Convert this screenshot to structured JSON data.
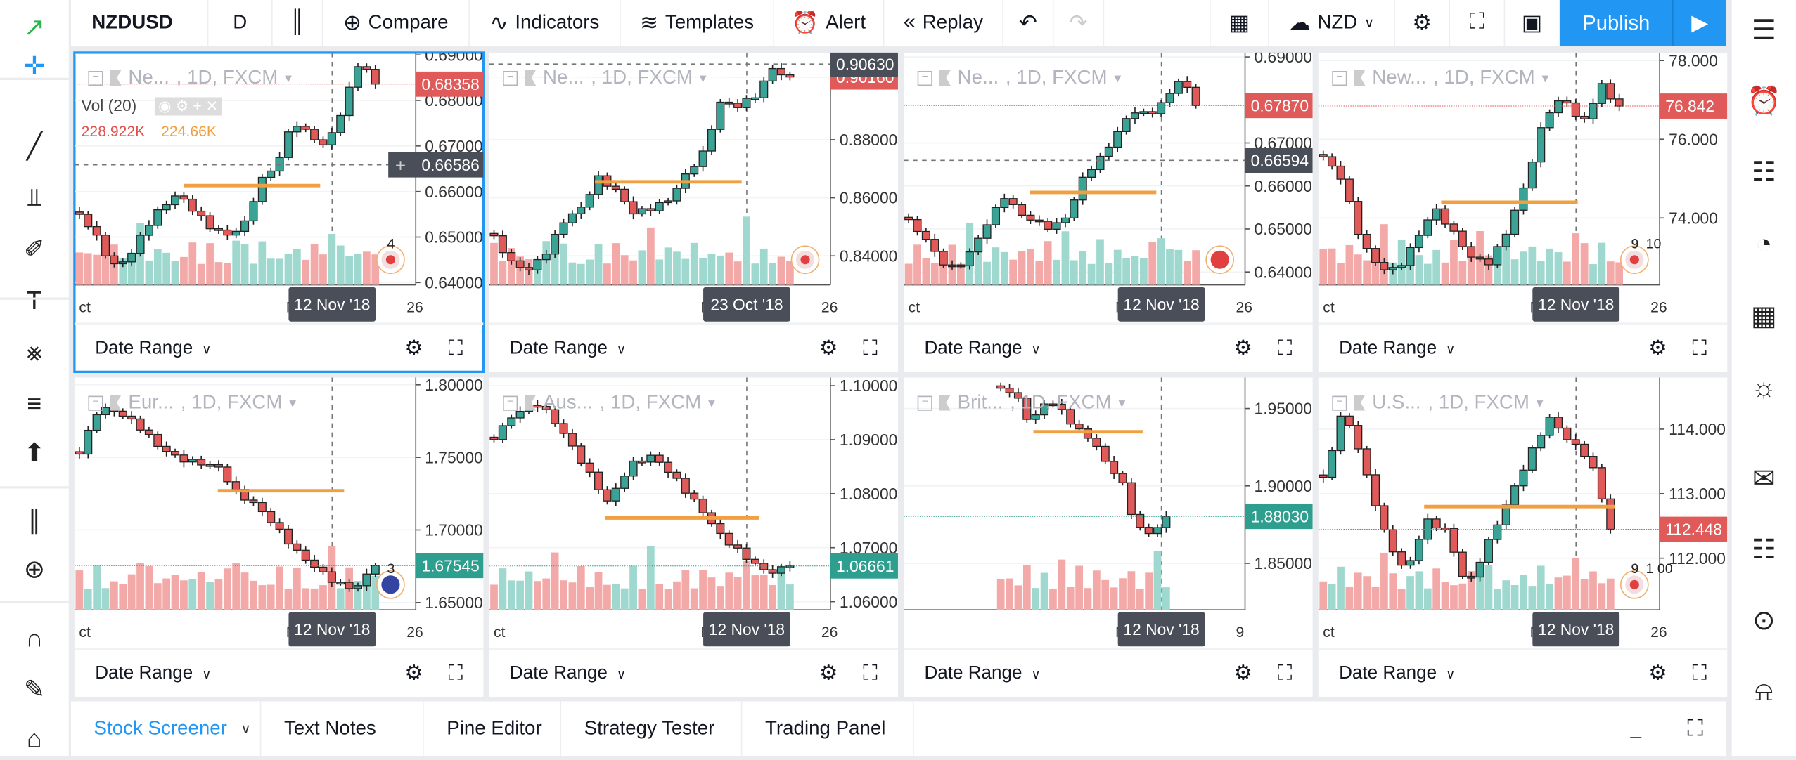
{
  "topbar": {
    "symbol": "NZDUSD",
    "interval": "D",
    "compare": "Compare",
    "indicators": "Indicators",
    "templates": "Templates",
    "alert": "Alert",
    "replay": "Replay",
    "currency": "NZD",
    "publish": "Publish",
    "icons": {
      "bar_style": "candles-icon",
      "compare": "plus-circle-icon",
      "indicators": "indicator-wave-icon",
      "templates": "templates-icon",
      "alert": "alarm-clock-icon",
      "replay": "rewind-icon",
      "undo": "undo-icon",
      "redo": "redo-icon",
      "layout": "grid-layout-icon",
      "cloud": "cloud-check-icon",
      "settings": "gear-icon",
      "fullscreen": "fullscreen-icon",
      "snapshot": "camera-icon",
      "play": "play-icon"
    }
  },
  "left_toolbar": [
    "logo-icon",
    "crosshair-icon",
    "trend-line-icon",
    "pitchfork-icon",
    "brush-icon",
    "text-icon",
    "pattern-icon",
    "prediction-icon",
    "arrow-up-icon",
    "ruler-icon",
    "zoom-in-icon",
    "magnet-icon",
    "lock-drawing-icon",
    "unlock-icon"
  ],
  "right_toolbar": [
    "watchlist-icon",
    "alerts-icon",
    "data-window-icon",
    "hotlist-icon",
    "calendar-icon",
    "ideas-icon",
    "chat-icon",
    "messages-icon",
    "streams-icon",
    "notifications-icon"
  ],
  "colors": {
    "accent": "#2196f3",
    "up": "#3aa395",
    "down": "#e05a5a",
    "vol_up": "#9fd8cf",
    "vol_down": "#f3a9a8",
    "level": "#f0a040",
    "crosshair_label": "#4a4e59"
  },
  "charts": [
    {
      "title": "Ne...",
      "suffix": ", 1D, FXCM",
      "y_ticks": [
        "0.69000",
        "0.68000",
        "0.67000",
        "0.66000",
        "0.65000",
        "0.64000"
      ],
      "y_range": [
        0.6395,
        0.6905
      ],
      "last_price": "0.68358",
      "last_color": "#e05a5a",
      "cross_price": "0.66586",
      "x_labels": [
        "ct",
        "Nov",
        "26"
      ],
      "cross_date": "12 Nov '18",
      "level": 0.6613,
      "closes": [
        0.655,
        0.65,
        0.643,
        0.645,
        0.652,
        0.657,
        0.66,
        0.656,
        0.652,
        0.65,
        0.652,
        0.662,
        0.666,
        0.676,
        0.673,
        0.67,
        0.678,
        0.688,
        0.684
      ],
      "badge": "4",
      "flag": "us",
      "selected": true,
      "vol_legend": {
        "label": "Vol (20)",
        "v1": "228.922K",
        "v2": "224.66K"
      }
    },
    {
      "title": "Ne...",
      "suffix": ", 1D, FXCM",
      "y_ticks": [
        "0.88000",
        "0.86000",
        "0.84000"
      ],
      "y_range": [
        0.83,
        0.91
      ],
      "last_price": "0.90160",
      "last_color": "#e05a5a",
      "cross_price": "0.90630",
      "x_labels": [
        "",
        "Nov",
        "26"
      ],
      "cross_date": "23 Oct '18",
      "level": 0.8655,
      "closes": [
        0.846,
        0.838,
        0.836,
        0.842,
        0.852,
        0.856,
        0.866,
        0.862,
        0.855,
        0.857,
        0.86,
        0.868,
        0.875,
        0.892,
        0.891,
        0.895,
        0.905,
        0.902
      ],
      "flag": "ca"
    },
    {
      "title": "Ne...",
      "suffix": ", 1D, FXCM",
      "y_ticks": [
        "0.69000",
        "0.67000",
        "0.66000",
        "0.65000",
        "0.64000"
      ],
      "y_range": [
        0.637,
        0.691
      ],
      "last_price": "0.67870",
      "last_color": "#e05a5a",
      "cross_price": "0.66594",
      "x_labels": [
        "ct",
        "Nov",
        "26"
      ],
      "cross_date": "12 Nov '18",
      "level": 0.6585,
      "closes": [
        0.652,
        0.648,
        0.642,
        0.64,
        0.645,
        0.652,
        0.658,
        0.654,
        0.652,
        0.65,
        0.653,
        0.662,
        0.666,
        0.672,
        0.678,
        0.677,
        0.68,
        0.685,
        0.679
      ],
      "flag": "ch"
    },
    {
      "title": "New...",
      "suffix": ", 1D, FXCM",
      "y_ticks": [
        "78.000",
        "76.000",
        "74.000"
      ],
      "y_range": [
        72.3,
        78.2
      ],
      "last_price": "76.842",
      "last_color": "#e05a5a",
      "x_labels": [
        "ct",
        "Nov",
        "26"
      ],
      "cross_date": "12 Nov '18",
      "level": 74.4,
      "closes": [
        75.5,
        75.0,
        73.5,
        72.8,
        72.7,
        73.4,
        74.2,
        73.6,
        73.0,
        72.9,
        73.8,
        75.0,
        76.6,
        77.0,
        76.3,
        77.4,
        76.8
      ],
      "badge": "9",
      "badge2": "10",
      "flag": "jp"
    },
    {
      "title": "Eur...",
      "suffix": ", 1D, FXCM",
      "y_ticks": [
        "1.80000",
        "1.75000",
        "1.70000",
        "1.65000"
      ],
      "y_range": [
        1.645,
        1.805
      ],
      "last_price": "1.67545",
      "last_color": "#2e9e8f",
      "x_labels": [
        "ct",
        "Nov",
        "26"
      ],
      "cross_date": "12 Nov '18",
      "level": 1.727,
      "closes": [
        1.755,
        1.785,
        1.78,
        1.77,
        1.757,
        1.75,
        1.748,
        1.745,
        1.725,
        1.715,
        1.7,
        1.685,
        1.675,
        1.665,
        1.66,
        1.6755
      ],
      "badge": "3",
      "flag": "eu"
    },
    {
      "title": "Aus...",
      "suffix": ", 1D, FXCM",
      "y_ticks": [
        "1.10000",
        "1.09000",
        "1.08000",
        "1.07000",
        "1.06000"
      ],
      "y_range": [
        1.0585,
        1.1015
      ],
      "last_price": "1.06661",
      "last_color": "#2e9e8f",
      "x_labels": [
        "ct",
        "Nov",
        "26"
      ],
      "cross_date": "12 Nov '18",
      "level": 1.0755,
      "closes": [
        1.09,
        1.095,
        1.097,
        1.092,
        1.085,
        1.078,
        1.085,
        1.087,
        1.083,
        1.078,
        1.072,
        1.068,
        1.065,
        1.0666
      ]
    },
    {
      "title": "Brit...",
      "suffix": ", 1D, FXCM",
      "y_ticks": [
        "1.95000",
        "1.90000",
        "1.85000"
      ],
      "y_range": [
        1.82,
        1.97
      ],
      "last_price": "1.88030",
      "last_color": "#2e9e8f",
      "x_labels": [
        "",
        "Nov",
        "9"
      ],
      "cross_date": "12 Nov '18",
      "level": 1.935,
      "closes": [
        1.965,
        1.96,
        1.94,
        1.955,
        1.948,
        1.935,
        1.93,
        1.915,
        1.905,
        1.875,
        1.87,
        1.8803
      ]
    },
    {
      "title": "U.S...",
      "suffix": ", 1D, FXCM",
      "y_ticks": [
        "114.000",
        "113.000",
        "112.000"
      ],
      "y_range": [
        111.2,
        114.8
      ],
      "last_price": "112.448",
      "last_color": "#e05a5a",
      "x_labels": [
        "ct",
        "Nov",
        "26"
      ],
      "cross_date": "12 Nov '18",
      "level": 112.8,
      "closes": [
        113.2,
        114.3,
        113.4,
        112.4,
        111.8,
        112.6,
        112.4,
        111.5,
        112.2,
        112.9,
        113.6,
        114.2,
        113.8,
        113.5,
        112.448
      ],
      "badge": "9",
      "badge2": "1 00",
      "flag": "jp"
    }
  ],
  "cell_footer": {
    "date_range": "Date Range",
    "settings_icon": "gear-icon",
    "fullscreen_icon": "fullscreen-icon"
  },
  "bottom_panel": {
    "tabs": [
      "Stock Screener",
      "Text Notes",
      "Pine Editor",
      "Strategy Tester",
      "Trading Panel"
    ],
    "active": "Stock Screener",
    "minimize": "_"
  }
}
